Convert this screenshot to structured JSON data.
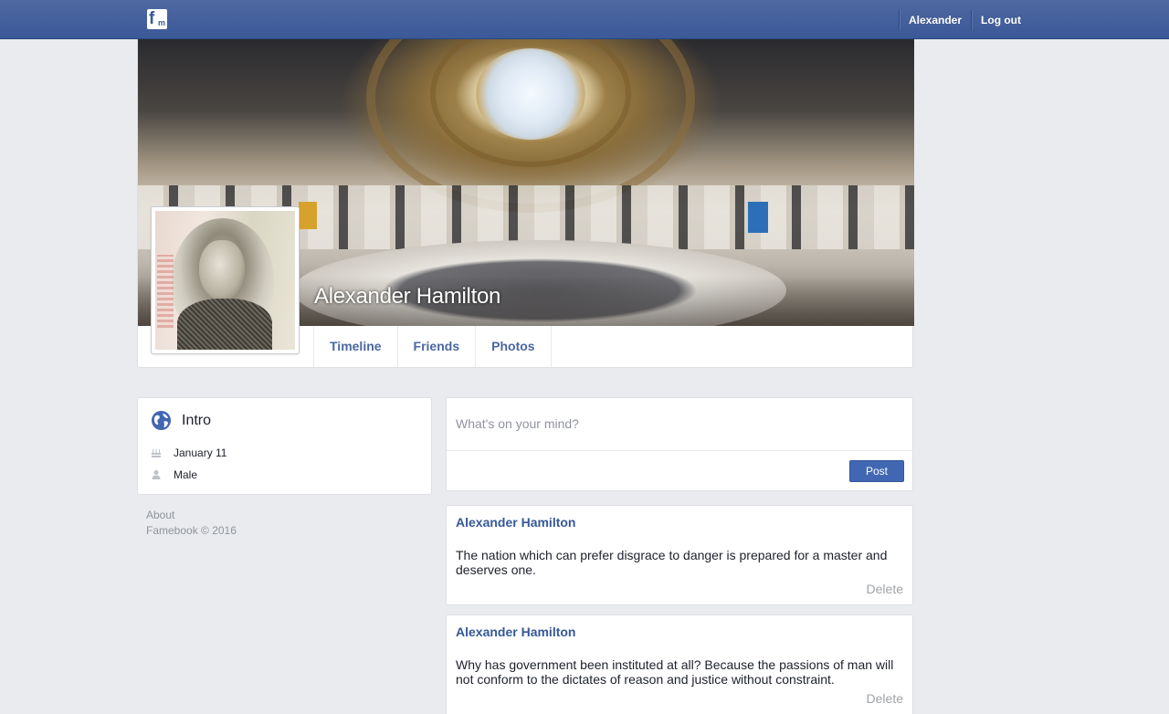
{
  "topbar": {
    "user_name": "Alexander",
    "logout_label": "Log out"
  },
  "profile": {
    "name": "Alexander Hamilton",
    "tabs": [
      {
        "label": "Timeline"
      },
      {
        "label": "Friends"
      },
      {
        "label": "Photos"
      }
    ]
  },
  "intro": {
    "title": "Intro",
    "birthday": "January 11",
    "gender": "Male"
  },
  "footer": {
    "about": "About",
    "copyright": "Famebook © 2016"
  },
  "composer": {
    "placeholder": "What's on your mind?",
    "post_label": "Post"
  },
  "posts": [
    {
      "author": "Alexander Hamilton",
      "body": "The nation which can prefer disgrace to danger is prepared for a master and deserves one.",
      "delete_label": "Delete"
    },
    {
      "author": "Alexander Hamilton",
      "body": "Why has government been instituted at all? Because the passions of man will not conform to the dictates of reason and justice without constraint.",
      "delete_label": "Delete"
    }
  ],
  "colors": {
    "brand": "#3b5998",
    "link": "#365899",
    "background": "#e9ebee"
  }
}
